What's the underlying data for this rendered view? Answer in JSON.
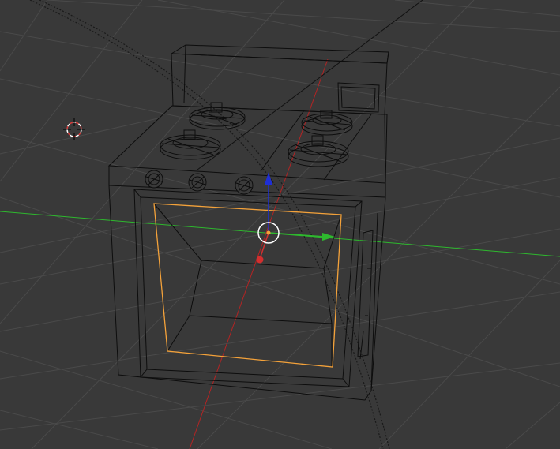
{
  "viewport": {
    "mode": "3d-wireframe",
    "object": "stove",
    "selected_part": "oven-door",
    "colors": {
      "background": "#393939",
      "grid": "#4a4a4a",
      "wire": "#0d0d0d",
      "selected": "#f4a23a",
      "axis_x": "#b32424",
      "axis_y": "#2eb82e",
      "axis_z": "#1f2fd6",
      "cursor_ring_red": "#d93b3b",
      "cursor_ring_white": "#ffffff"
    },
    "icons": [
      "3d-cursor-icon",
      "transform-gizmo-icon",
      "object-origin-icon"
    ]
  }
}
